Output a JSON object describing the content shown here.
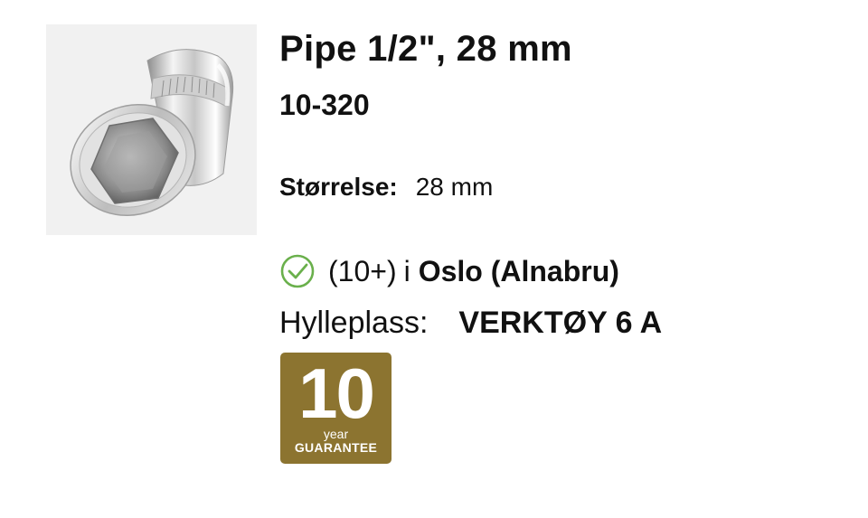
{
  "product": {
    "image_icon": "socket-wrench-image",
    "title": "Pipe 1/2\", 28 mm",
    "sku": "10-320",
    "size_label": "Størrelse:",
    "size_value": "28 mm"
  },
  "stock": {
    "status_icon": "check-circle-icon",
    "status_color": "#6ab04c",
    "quantity": "(10+)",
    "in_word": "i",
    "location": "Oslo (Alnabru)"
  },
  "shelf": {
    "label": "Hylleplass:",
    "value": "VERKTØY 6 A"
  },
  "guarantee": {
    "number": "10",
    "unit": "year",
    "word": "GUARANTEE",
    "color": "#8c7430"
  }
}
